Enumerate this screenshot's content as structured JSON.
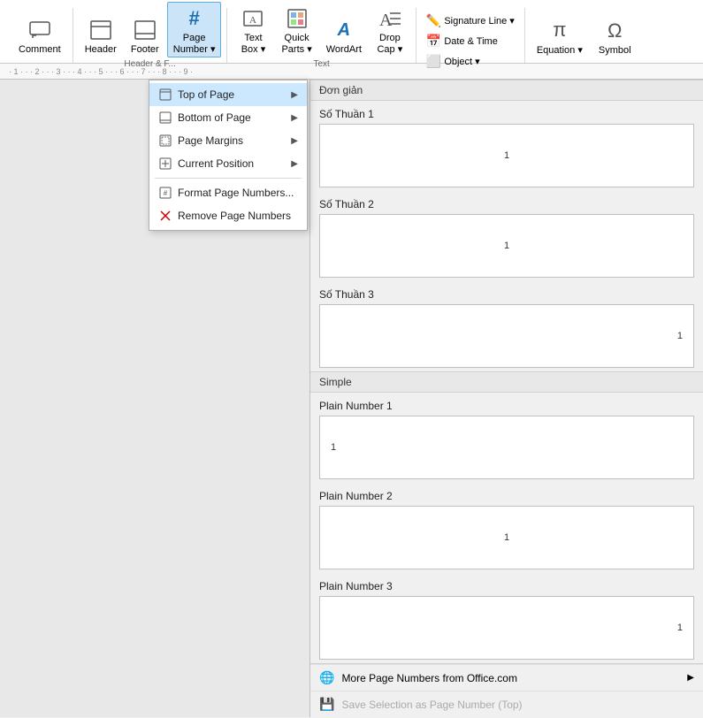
{
  "ribbon": {
    "groups": [
      {
        "name": "comments",
        "buttons": [
          {
            "id": "comment-btn",
            "label": "Comment",
            "icon": "💬"
          }
        ]
      },
      {
        "name": "header-footer",
        "label": "Header & F...",
        "buttons": [
          {
            "id": "header-btn",
            "label": "Header",
            "icon": "⬆"
          },
          {
            "id": "footer-btn",
            "label": "Footer",
            "icon": "⬇"
          },
          {
            "id": "page-number-btn",
            "label": "Page\nNumber",
            "icon": "#",
            "active": true
          }
        ]
      },
      {
        "name": "text",
        "buttons": [
          {
            "id": "textbox-btn",
            "label": "Text\nBox",
            "icon": "A"
          },
          {
            "id": "quickparts-btn",
            "label": "Quick\nParts",
            "icon": "⬜"
          },
          {
            "id": "wordart-btn",
            "label": "WordArt",
            "icon": "W"
          },
          {
            "id": "dropcap-btn",
            "label": "Drop\nCap",
            "icon": "D"
          }
        ]
      },
      {
        "name": "signature",
        "small_buttons": [
          {
            "id": "signature-line-btn",
            "label": "Signature Line",
            "icon": "✏"
          },
          {
            "id": "date-time-btn",
            "label": "Date & Time",
            "icon": "📅"
          },
          {
            "id": "object-btn",
            "label": "Object",
            "icon": "⬜"
          }
        ]
      },
      {
        "name": "equation-symbol",
        "buttons": [
          {
            "id": "equation-btn",
            "label": "Equation",
            "icon": "π"
          },
          {
            "id": "symbol-btn",
            "label": "Symbol",
            "icon": "Ω"
          }
        ]
      }
    ]
  },
  "menu": {
    "items": [
      {
        "id": "top-of-page",
        "label": "Top of Page",
        "icon": "📄",
        "arrow": true,
        "hovered": true
      },
      {
        "id": "bottom-of-page",
        "label": "Bottom of Page",
        "icon": "📄",
        "arrow": true
      },
      {
        "id": "page-margins",
        "label": "Page Margins",
        "icon": "📄",
        "arrow": true
      },
      {
        "id": "current-position",
        "label": "Current Position",
        "icon": "📄",
        "arrow": true
      },
      {
        "id": "format-page-numbers",
        "label": "Format Page Numbers...",
        "icon": "📄"
      },
      {
        "id": "remove-page-numbers",
        "label": "Remove Page Numbers",
        "icon": "✖"
      }
    ]
  },
  "panel": {
    "sections": [
      {
        "id": "don-gian-section",
        "header": "Đơn giản",
        "items": [
          {
            "id": "so-thuan-1",
            "label": "Số Thuần 1",
            "number_pos": "center",
            "number": "1"
          },
          {
            "id": "so-thuan-2",
            "label": "Số Thuần 2",
            "number_pos": "center",
            "number": "1"
          },
          {
            "id": "so-thuan-3",
            "label": "Số Thuần 3",
            "number_pos": "right",
            "number": "1"
          }
        ]
      },
      {
        "id": "simple-section",
        "header": "Simple",
        "items": [
          {
            "id": "plain-number-1",
            "label": "Plain Number 1",
            "number_pos": "left",
            "number": "1"
          },
          {
            "id": "plain-number-2",
            "label": "Plain Number 2",
            "number_pos": "center",
            "number": "1"
          },
          {
            "id": "plain-number-3",
            "label": "Plain Number 3",
            "number_pos": "right",
            "number": "1"
          }
        ]
      }
    ],
    "bottom_items": [
      {
        "id": "more-page-numbers",
        "label": "More Page Numbers from Office.com",
        "icon": "🌐",
        "arrow": true,
        "disabled": false
      },
      {
        "id": "save-selection",
        "label": "Save Selection as Page Number (Top)",
        "icon": "💾",
        "disabled": true
      }
    ]
  },
  "ruler": {
    "marks": "· 1 · · · 2 · · · 3 · · · 4 · · · 5 · · · 6 · · · 7 · · · 8 · · · 9 ·"
  }
}
